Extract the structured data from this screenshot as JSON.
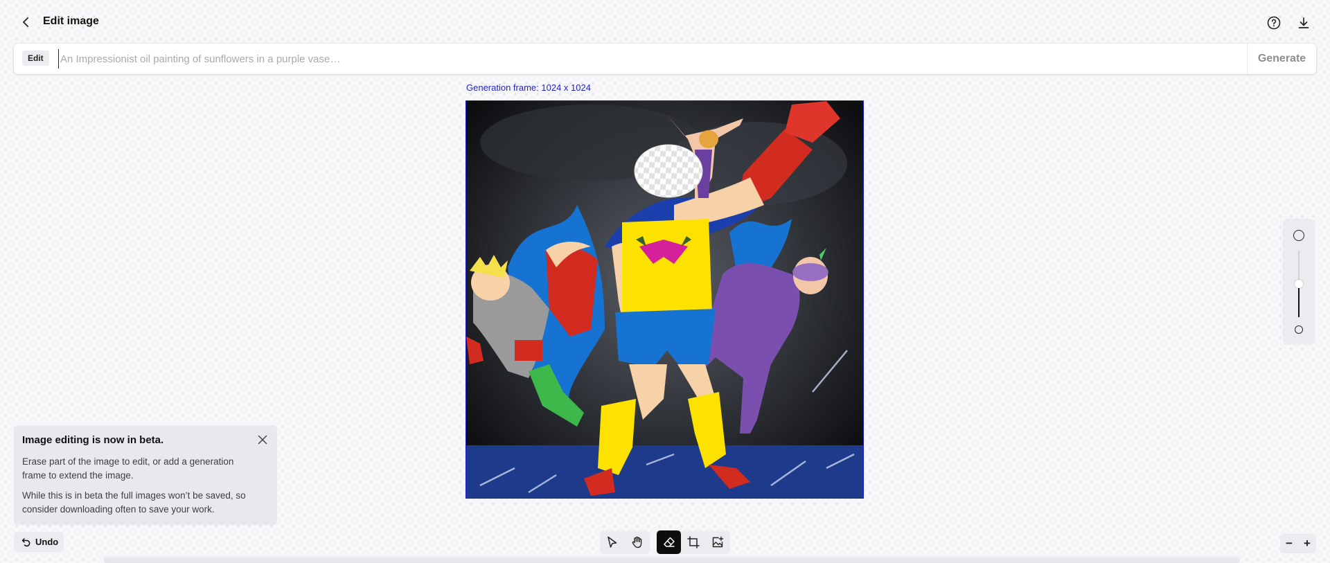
{
  "header": {
    "title": "Edit image",
    "back_icon": "chevron-left-icon",
    "help_icon": "help-circle-icon",
    "download_icon": "download-icon"
  },
  "prompt": {
    "mode_chip": "Edit",
    "value": "",
    "placeholder": "An Impressionist oil painting of sunflowers in a purple vase…",
    "generate_label": "Generate"
  },
  "canvas": {
    "frame_label": "Generation frame: 1024 x 1024",
    "frame_color": "#1a1acc"
  },
  "brush_size_slider": {
    "level": 0.5
  },
  "beta_notice": {
    "title": "Image editing is now in beta.",
    "paragraph_1": "Erase part of the image to edit, or add a generation frame to extend the image.",
    "paragraph_2": "While this is in beta the full images won’t be saved, so consider downloading often to save your work."
  },
  "undo": {
    "label": "Undo",
    "icon": "undo-icon"
  },
  "toolbar": {
    "group_1": [
      "select-pointer-icon",
      "pan-hand-icon"
    ],
    "group_2": [
      "eraser-icon",
      "add-frame-icon",
      "upload-image-icon"
    ],
    "active_tool": "eraser-icon"
  },
  "zoom_controls": {
    "zoom_out": "−",
    "zoom_in": "+"
  }
}
